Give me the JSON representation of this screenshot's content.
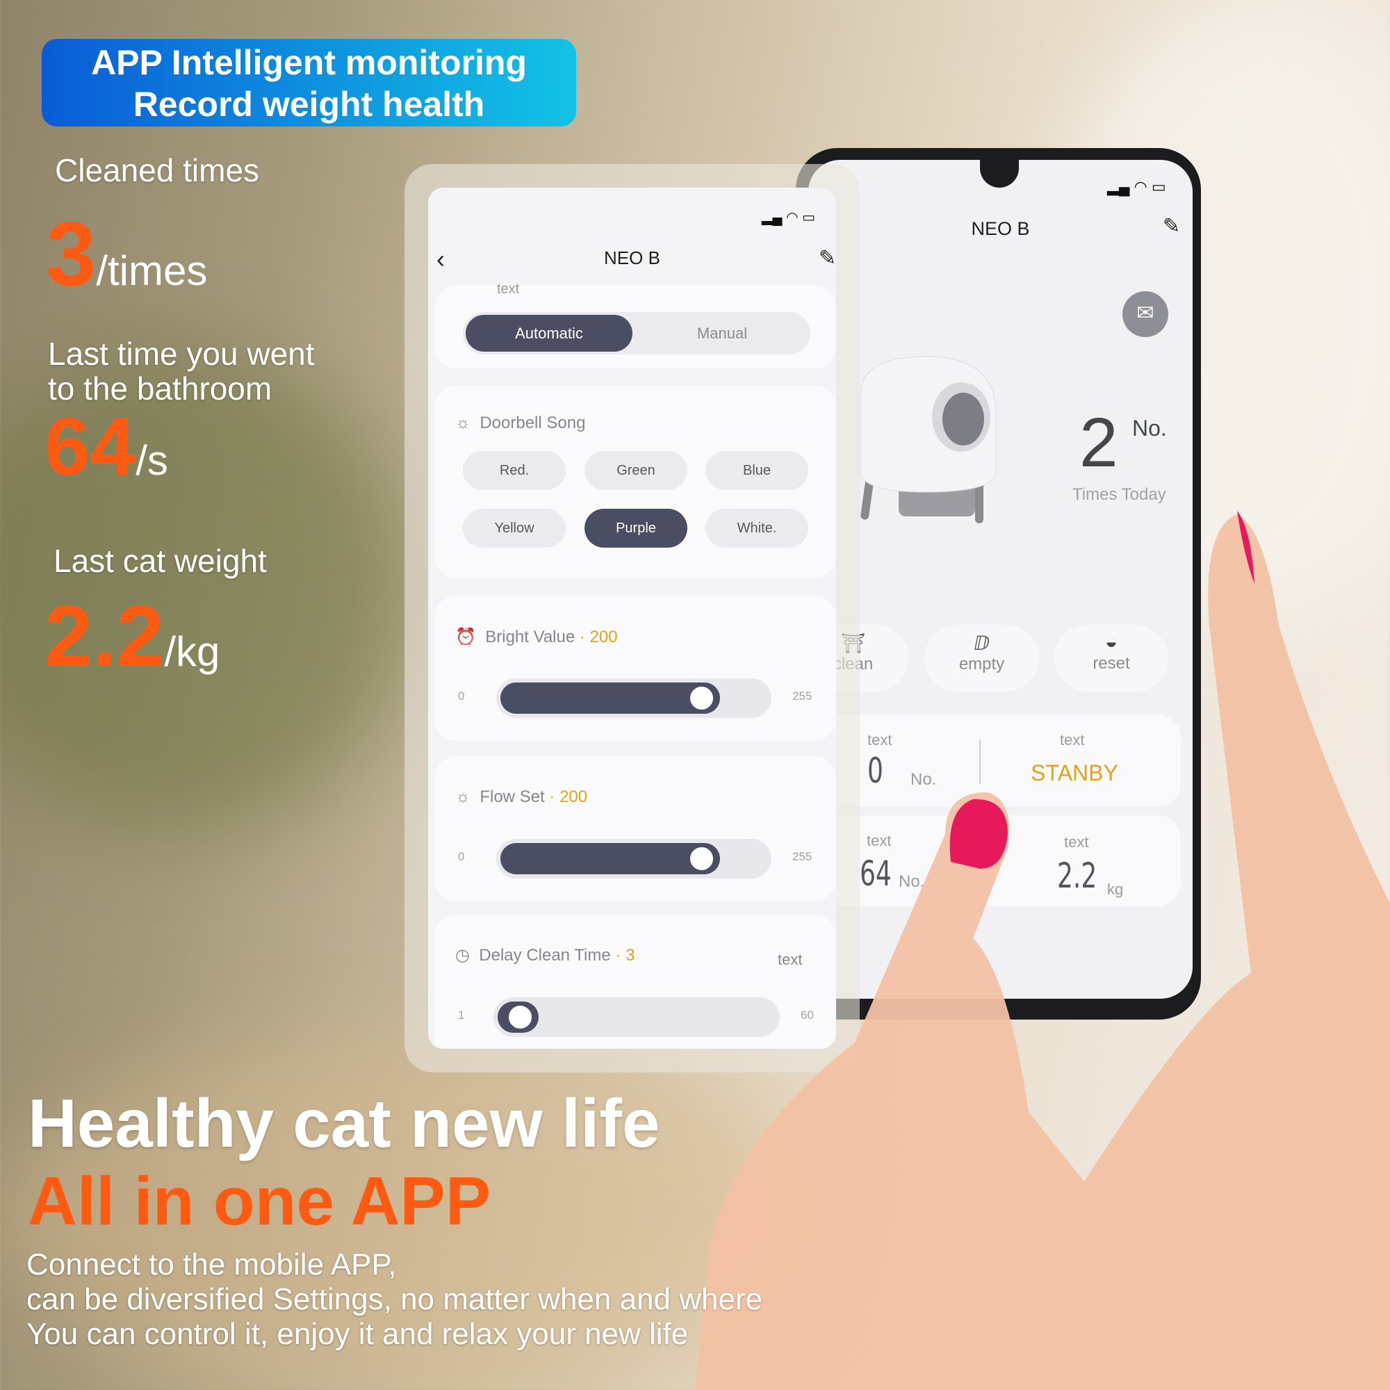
{
  "banner": {
    "line1": "APP Intelligent monitoring",
    "line2": "Record weight health"
  },
  "stats": {
    "cleaned_label": "Cleaned times",
    "cleaned_value": "3",
    "cleaned_unit": "/times",
    "bathroom_label1": "Last time you went",
    "bathroom_label2": "to the bathroom",
    "bathroom_value": "64",
    "bathroom_unit": "/s",
    "weight_label": "Last cat weight",
    "weight_value": "2.2",
    "weight_unit": "/kg"
  },
  "headline": {
    "line1": "Healthy cat new life",
    "line2": "All in one APP",
    "para": [
      "Connect to the mobile APP,",
      "can be diversified Settings, no matter when and where",
      "You can control it, enjoy it and relax your new life"
    ]
  },
  "settings_screen": {
    "title": "NEO B",
    "partial_label": "text",
    "mode": {
      "options": [
        "Automatic",
        "Manual"
      ],
      "selected": "Automatic"
    },
    "doorbell": {
      "title": "Doorbell Song",
      "options": [
        "Red.",
        "Green",
        "Blue",
        "Yellow",
        "Purple",
        "White."
      ],
      "selected": "Purple"
    },
    "bright": {
      "title": "Bright Value",
      "value": 200,
      "min": 0,
      "max": 255,
      "value_text": "200",
      "min_text": "0",
      "max_text": "255"
    },
    "flow": {
      "title": "Flow Set",
      "value": 200,
      "min": 0,
      "max": 255,
      "value_text": "200",
      "min_text": "0",
      "max_text": "255"
    },
    "delay": {
      "title": "Delay Clean Time",
      "value": 3,
      "min": 1,
      "max": 60,
      "value_text": "3",
      "min_text": "1",
      "max_text": "60",
      "right_label": "text"
    }
  },
  "home_screen": {
    "title": "NEO B",
    "times_today_value": "2",
    "times_today_unit": "No.",
    "times_today_label": "Times Today",
    "actions": [
      {
        "label": "clean",
        "icon": "broom-icon"
      },
      {
        "label": "empty",
        "icon": "empty-icon"
      },
      {
        "label": "reset",
        "icon": "reset-icon"
      }
    ],
    "cards": [
      {
        "label": "text",
        "value": "0",
        "unit": "No."
      },
      {
        "label": "text",
        "value": "STANBY"
      },
      {
        "label": "text",
        "value": "64",
        "unit": "No."
      },
      {
        "label": "text",
        "value": "2.2",
        "unit": "kg"
      }
    ]
  },
  "colors": {
    "accent_orange": "#ff5a12",
    "dark_pill": "#4b4e63",
    "status_yellow": "#e3a21a"
  }
}
